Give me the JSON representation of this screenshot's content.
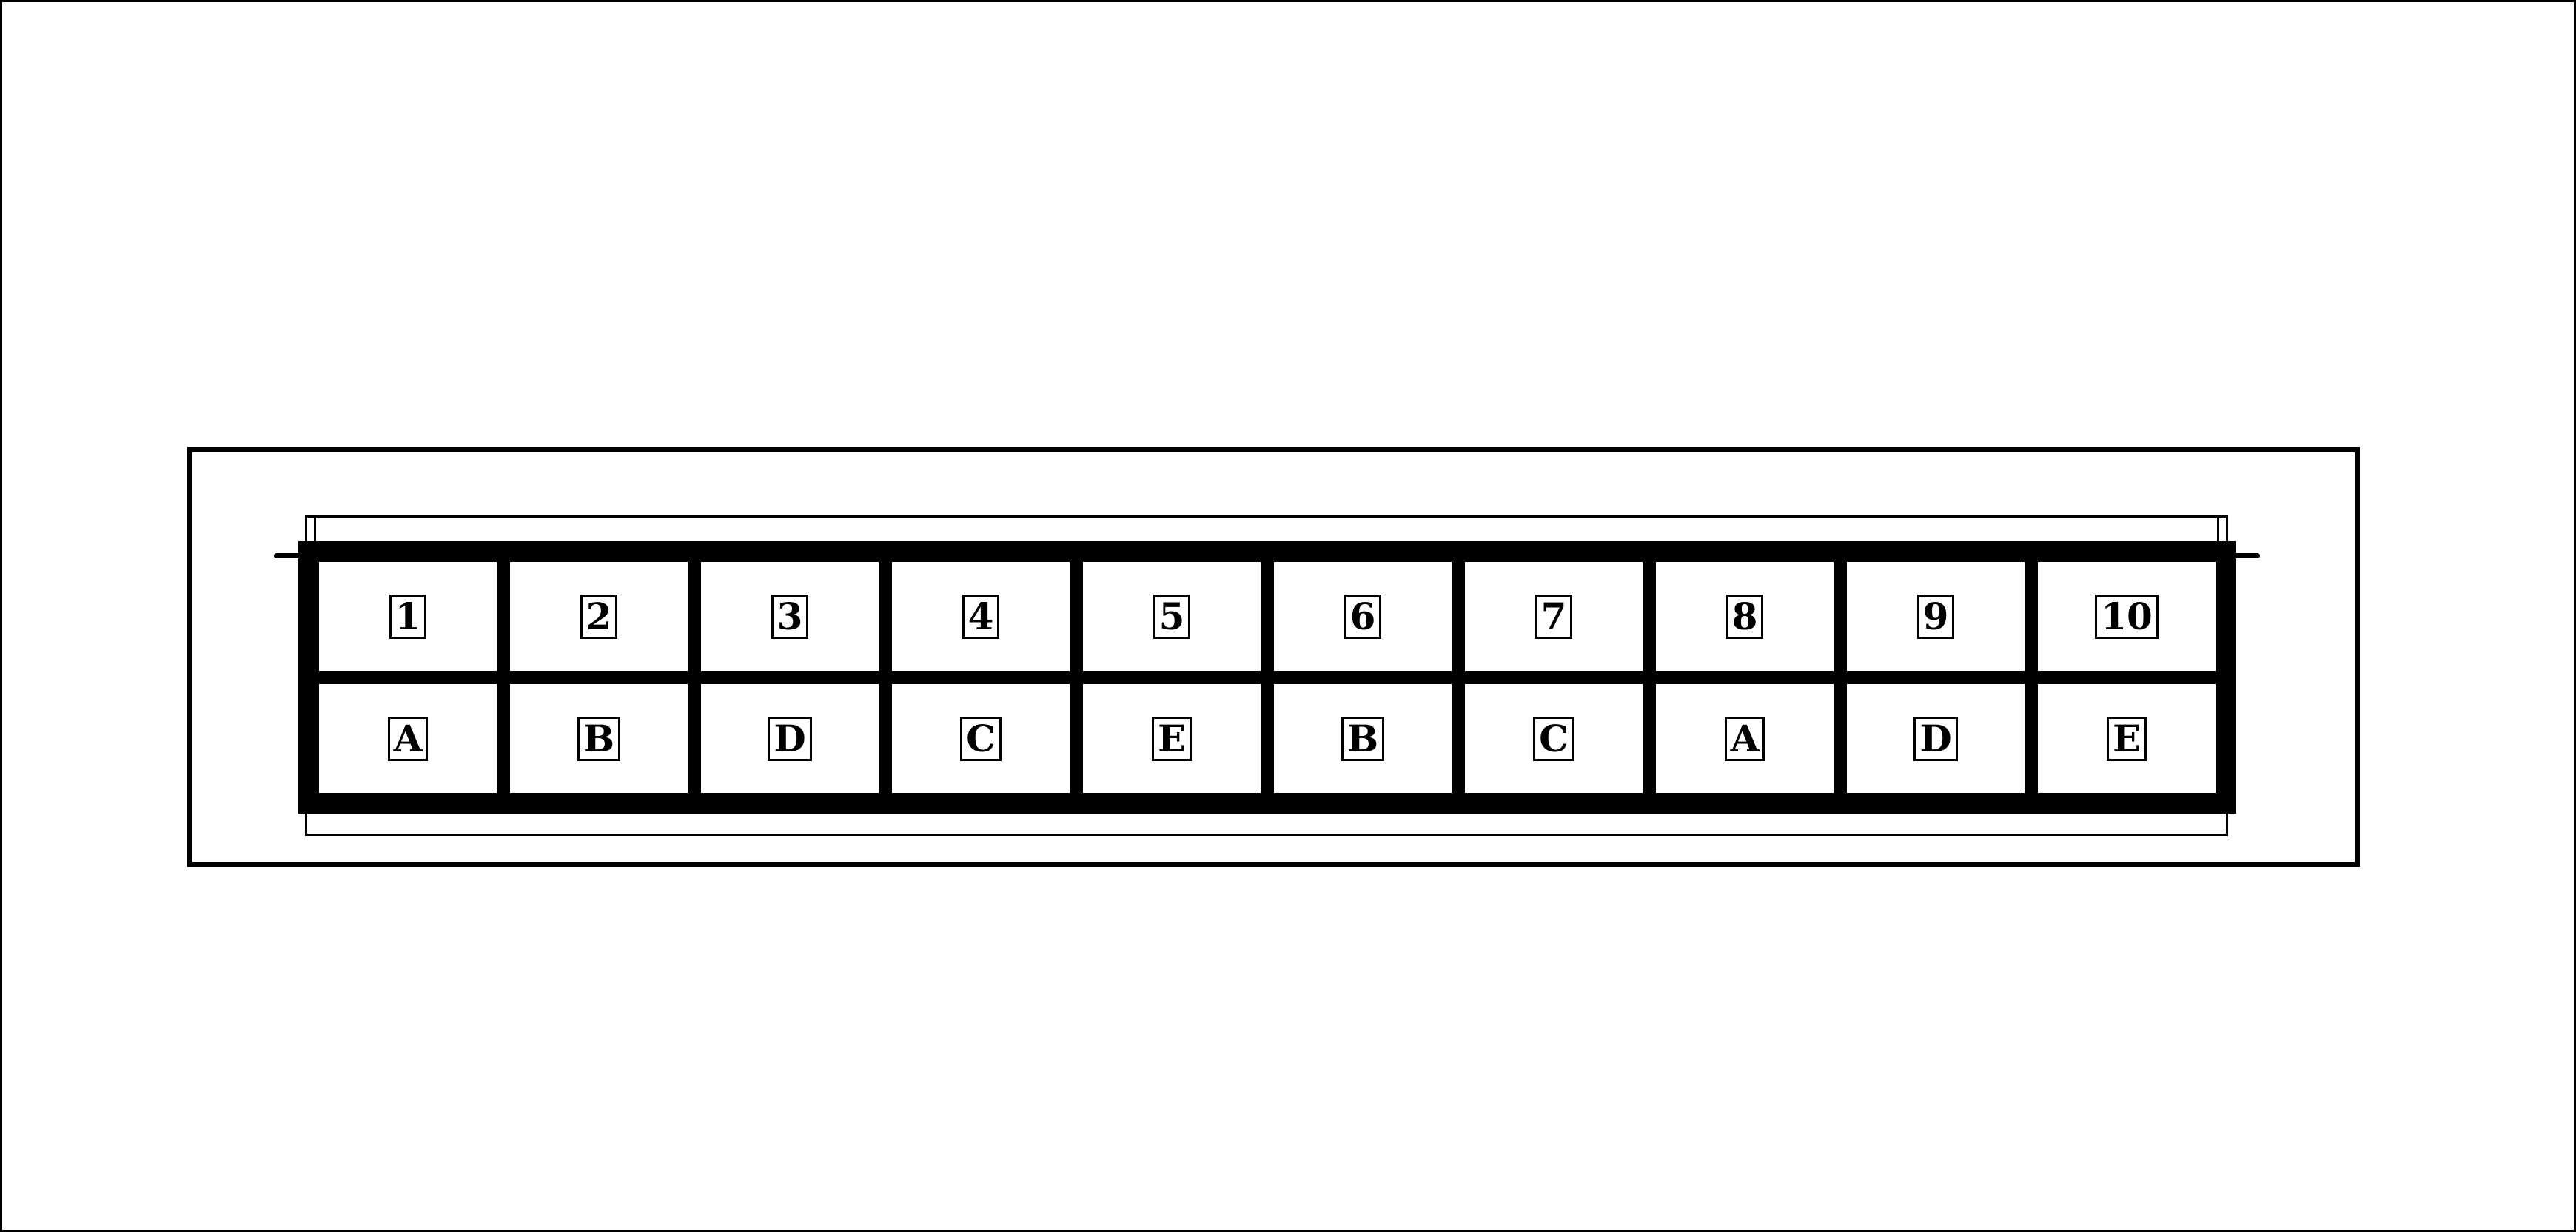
{
  "diagram": {
    "row_1": [
      "1",
      "2",
      "3",
      "4",
      "5",
      "6",
      "7",
      "8",
      "9",
      "10"
    ],
    "row_2": [
      "A",
      "B",
      "D",
      "C",
      "E",
      "B",
      "C",
      "A",
      "D",
      "E"
    ]
  }
}
